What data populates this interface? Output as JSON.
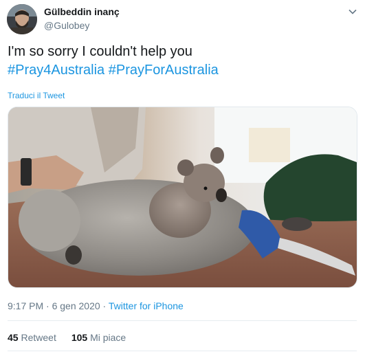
{
  "author": {
    "name": "Gülbeddin inanç",
    "handle": "@Gulobey"
  },
  "tweet": {
    "text": "I'm so sorry I couldn't help you",
    "hashtag1": "#Pray4Australia",
    "hashtag2": "#PrayForAustralia",
    "translate_label": "Traduci il Tweet"
  },
  "meta": {
    "time": "9:17 PM",
    "separator1": " · ",
    "date": "6 gen 2020",
    "separator2": " · ",
    "source": "Twitter for iPhone"
  },
  "stats": {
    "retweets_count": "45",
    "retweets_label": "Retweet",
    "likes_count": "105",
    "likes_label": "Mi piace"
  },
  "icons": {
    "more": "chevron-down-icon"
  },
  "colors": {
    "link": "#1b95e0",
    "secondary": "#657786",
    "primary_text": "#14171a"
  }
}
